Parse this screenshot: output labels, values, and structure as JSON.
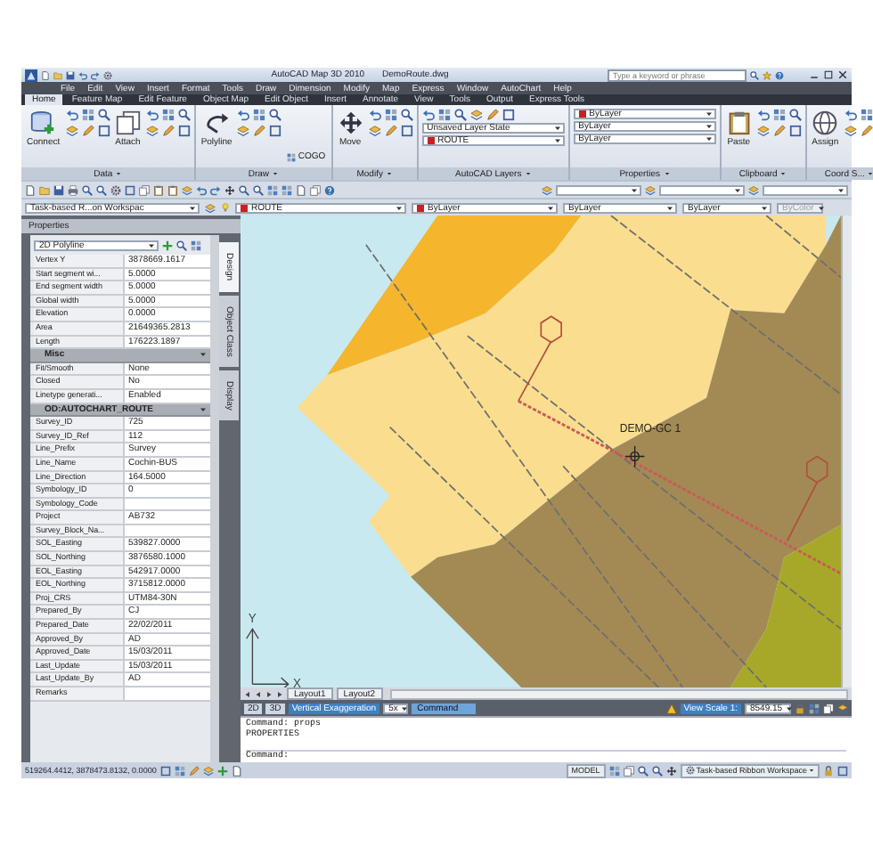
{
  "window": {
    "app_title": "AutoCAD Map 3D 2010",
    "document": "DemoRoute.dwg",
    "search_placeholder": "Type a keyword or phrase"
  },
  "menu": [
    "File",
    "Edit",
    "View",
    "Insert",
    "Format",
    "Tools",
    "Draw",
    "Dimension",
    "Modify",
    "Map",
    "Express",
    "Window",
    "AutoChart",
    "Help"
  ],
  "ribbon_tabs": [
    {
      "label": "Home",
      "selected": true
    },
    {
      "label": "Feature Map",
      "selected": false
    },
    {
      "label": "Edit Feature",
      "selected": false
    },
    {
      "label": "Object Map",
      "selected": false
    },
    {
      "label": "Edit Object",
      "selected": false
    },
    {
      "label": "Insert",
      "selected": false
    },
    {
      "label": "Annotate",
      "selected": false
    },
    {
      "label": "View",
      "selected": false
    },
    {
      "label": "Tools",
      "selected": false
    },
    {
      "label": "Output",
      "selected": false
    },
    {
      "label": "Express Tools",
      "selected": false
    }
  ],
  "ribbon_panels": [
    {
      "title": "Data",
      "kind": "row",
      "items": [
        {
          "kind": "large",
          "label": "Connect"
        },
        {
          "kind": "tools"
        },
        {
          "kind": "large",
          "label": "Attach"
        },
        {
          "kind": "tools"
        }
      ]
    },
    {
      "title": "Draw",
      "kind": "row",
      "items": [
        {
          "kind": "large",
          "label": "Polyline"
        },
        {
          "kind": "tools"
        },
        {
          "kind": "small",
          "label": "COGO"
        }
      ]
    },
    {
      "title": "Modify",
      "kind": "row",
      "items": [
        {
          "kind": "large",
          "label": "Move"
        },
        {
          "kind": "tools"
        }
      ]
    },
    {
      "title": "AutoCAD Layers",
      "kind": "column",
      "items": [
        {
          "kind": "tools"
        },
        {
          "kind": "combo",
          "text": "Unsaved Layer State"
        },
        {
          "kind": "combo",
          "text": "ROUTE",
          "color": "#cc1f1f"
        }
      ]
    },
    {
      "title": "Properties",
      "kind": "column",
      "items": [
        {
          "kind": "combo",
          "text": "ByLayer",
          "color": "#cc1f1f"
        },
        {
          "kind": "combo",
          "text": "ByLayer"
        },
        {
          "kind": "combo",
          "text": "ByLayer"
        }
      ]
    },
    {
      "title": "Clipboard",
      "kind": "row",
      "items": [
        {
          "kind": "large",
          "label": "Paste"
        },
        {
          "kind": "tools"
        }
      ]
    },
    {
      "title": "Coord S...",
      "kind": "row",
      "items": [
        {
          "kind": "large",
          "label": "Assign"
        },
        {
          "kind": "tools"
        }
      ]
    }
  ],
  "toolbar2": [
    {
      "text": "Task-based R...on Workspac",
      "disabled": false
    },
    {
      "text": "ROUTE",
      "color": "#cc1f1f",
      "disabled": false
    },
    {
      "text": "ByLayer",
      "color": "#cc1f1f",
      "disabled": false
    },
    {
      "text": "ByLayer",
      "disabled": false
    },
    {
      "text": "ByLayer",
      "disabled": false
    },
    {
      "text": "ByColor",
      "disabled": true
    }
  ],
  "palette": {
    "title": "Properties",
    "object_type": "2D Polyline",
    "side_tabs": [
      {
        "label": "Design",
        "selected": true
      },
      {
        "label": "Object Class",
        "selected": false
      },
      {
        "label": "Display",
        "selected": false
      }
    ],
    "rows": [
      {
        "kind": "row",
        "name": "Vertex Y",
        "value": "3878669.1617"
      },
      {
        "kind": "row",
        "name": "Start segment wi...",
        "value": "5.0000"
      },
      {
        "kind": "row",
        "name": "End segment width",
        "value": "5.0000"
      },
      {
        "kind": "row",
        "name": "Global width",
        "value": "5.0000"
      },
      {
        "kind": "row",
        "name": "Elevation",
        "value": "0.0000"
      },
      {
        "kind": "row",
        "name": "Area",
        "value": "21649365.2813"
      },
      {
        "kind": "row",
        "name": "Length",
        "value": "176223.1897"
      },
      {
        "kind": "section",
        "name": "Misc"
      },
      {
        "kind": "row",
        "name": "Fit/Smooth",
        "value": "None"
      },
      {
        "kind": "row",
        "name": "Closed",
        "value": "No"
      },
      {
        "kind": "row",
        "name": "Linetype generati...",
        "value": "Enabled"
      },
      {
        "kind": "section",
        "name": "OD:AUTOCHART_ROUTE"
      },
      {
        "kind": "row",
        "name": "Survey_ID",
        "value": "725"
      },
      {
        "kind": "row",
        "name": "Survey_ID_Ref",
        "value": "112"
      },
      {
        "kind": "row",
        "name": "Line_Prefix",
        "value": "Survey"
      },
      {
        "kind": "row",
        "name": "Line_Name",
        "value": "Cochin-BUS"
      },
      {
        "kind": "row",
        "name": "Line_Direction",
        "value": "164.5000"
      },
      {
        "kind": "row",
        "name": "Symbology_ID",
        "value": "0"
      },
      {
        "kind": "row",
        "name": "Symbology_Code"
      },
      {
        "kind": "row",
        "name": "Project",
        "value": "AB732"
      },
      {
        "kind": "row",
        "name": "Survey_Block_Na..."
      },
      {
        "kind": "row",
        "name": "SOL_Easting",
        "value": "539827.0000"
      },
      {
        "kind": "row",
        "name": "SOL_Northing",
        "value": "3876580.1000"
      },
      {
        "kind": "row",
        "name": "EOL_Easting",
        "value": "542917.0000"
      },
      {
        "kind": "row",
        "name": "EOL_Northing",
        "value": "3715812.0000"
      },
      {
        "kind": "row",
        "name": "Proj_CRS",
        "value": "UTM84-30N"
      },
      {
        "kind": "row",
        "name": "Prepared_By",
        "value": "CJ"
      },
      {
        "kind": "row",
        "name": "Prepared_Date",
        "value": "22/02/2011"
      },
      {
        "kind": "row",
        "name": "Approved_By",
        "value": "AD"
      },
      {
        "kind": "row",
        "name": "Approved_Date",
        "value": "15/03/2011"
      },
      {
        "kind": "row",
        "name": "Last_Update",
        "value": "15/03/2011"
      },
      {
        "kind": "row",
        "name": "Last_Update_By",
        "value": "AD"
      },
      {
        "kind": "row",
        "name": "Remarks"
      }
    ]
  },
  "map": {
    "point_label": "DEMO-GC 1",
    "axis_labels": [
      "Y",
      "X"
    ]
  },
  "layout_tabs": [
    {
      "label": "Layout1",
      "selected": false
    },
    {
      "label": "Layout2",
      "selected": false
    }
  ],
  "status": {
    "toggles": [
      "2D",
      "3D"
    ],
    "exaggeration_label": "Vertical Exaggeration",
    "exaggeration": "5x",
    "command_tab": "Command",
    "view_scale_label": "View Scale 1:",
    "view_scale": "8549.15"
  },
  "command": {
    "history": [
      "Command: props",
      "PROPERTIES"
    ],
    "prompt": "Command:"
  },
  "status_bar": {
    "coordinates": "519264.4412, 3878473.8132, 0.0000",
    "model": "MODEL",
    "workspace": "Task-based Ribbon Workspace"
  }
}
